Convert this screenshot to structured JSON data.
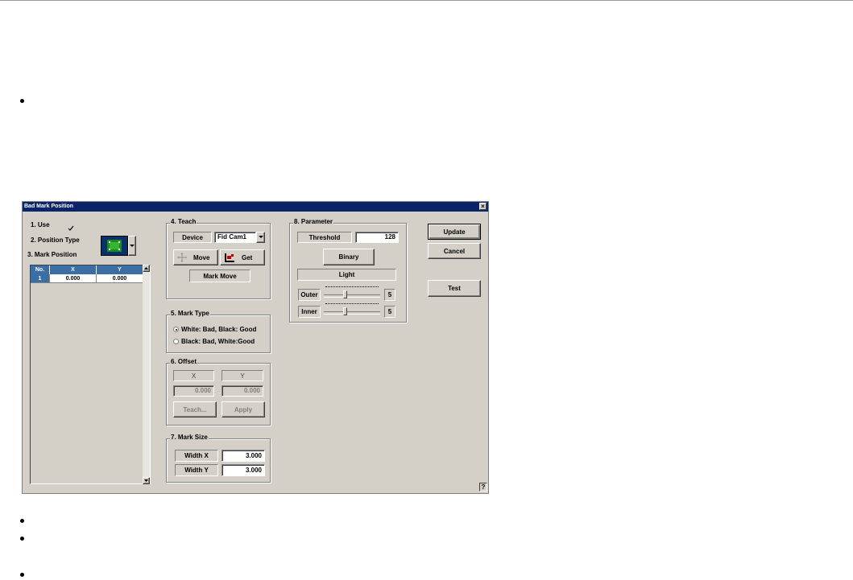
{
  "dialog": {
    "title": "Bad Mark Position",
    "close_glyph": "×",
    "help_glyph": "?"
  },
  "left": {
    "use_label": "1. Use",
    "use_checked": true,
    "position_type_label": "2. Position Type",
    "mark_position_label": "3. Mark Position",
    "table": {
      "headers": [
        "No.",
        "X",
        "Y"
      ],
      "rows": [
        [
          "1",
          "0.000",
          "0.000"
        ]
      ]
    }
  },
  "teach": {
    "title": "4. Teach",
    "device_label": "Device",
    "device_value": "Fid Cam1",
    "move_label": "Move",
    "get_label": "Get",
    "mark_move_label": "Mark Move"
  },
  "mark_type": {
    "title": "5. Mark Type",
    "options": [
      "White: Bad, Black: Good",
      "Black: Bad, White:Good"
    ],
    "selected": 0
  },
  "offset": {
    "title": "6. Offset",
    "x_label": "X",
    "y_label": "Y",
    "x_value": "0.000",
    "y_value": "0.000",
    "teach_label": "Teach...",
    "apply_label": "Apply"
  },
  "mark_size": {
    "title": "7. Mark Size",
    "width_x_label": "Width X",
    "width_x_value": "3.000",
    "width_y_label": "Width Y",
    "width_y_value": "3.000"
  },
  "parameter": {
    "title": "8. Parameter",
    "threshold_label": "Threshold",
    "threshold_value": "128",
    "binary_label": "Binary",
    "light_label": "Light",
    "outer_label": "Outer",
    "outer_value": "5",
    "inner_label": "Inner",
    "inner_value": "5"
  },
  "actions": {
    "update_label": "Update",
    "cancel_label": "Cancel",
    "test_label": "Test"
  },
  "colors": {
    "title_bar": "#0a246a",
    "dialog_bg": "#d4d0c8",
    "grid_header": "#3a6ea5"
  }
}
